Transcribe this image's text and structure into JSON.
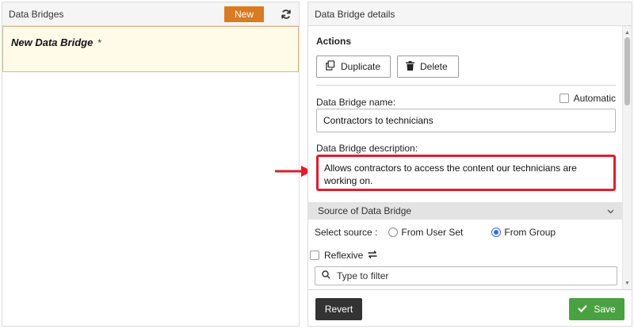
{
  "left_panel": {
    "title": "Data Bridges",
    "new_label": "New",
    "refresh_icon": "refresh-icon",
    "items": [
      {
        "name": "New Data Bridge",
        "marker": "*"
      }
    ]
  },
  "right_panel": {
    "title": "Data Bridge details",
    "actions": {
      "heading": "Actions",
      "duplicate_label": "Duplicate",
      "delete_label": "Delete"
    },
    "name_field": {
      "label": "Data Bridge name:",
      "value": "Contractors to technicians",
      "automatic_label": "Automatic",
      "automatic_checked": false
    },
    "description_field": {
      "label": "Data Bridge description:",
      "value": "Allows contractors to access the content our technicians are working on."
    },
    "source_section": {
      "heading": "Source of Data Bridge",
      "select_label": "Select source :",
      "options": [
        {
          "label": "From User Set",
          "selected": false
        },
        {
          "label": "From Group",
          "selected": true
        }
      ],
      "reflexive_label": "Reflexive",
      "reflexive_checked": false,
      "filter_placeholder": "Type to filter"
    },
    "footer": {
      "revert_label": "Revert",
      "save_label": "Save"
    }
  },
  "colors": {
    "new_button": "#d97b22",
    "save_button": "#48a23f",
    "revert_button": "#333333",
    "highlight": "#e11d2a",
    "radio_selected": "#2f6fe0",
    "item_selected_bg": "#fffbe8"
  }
}
